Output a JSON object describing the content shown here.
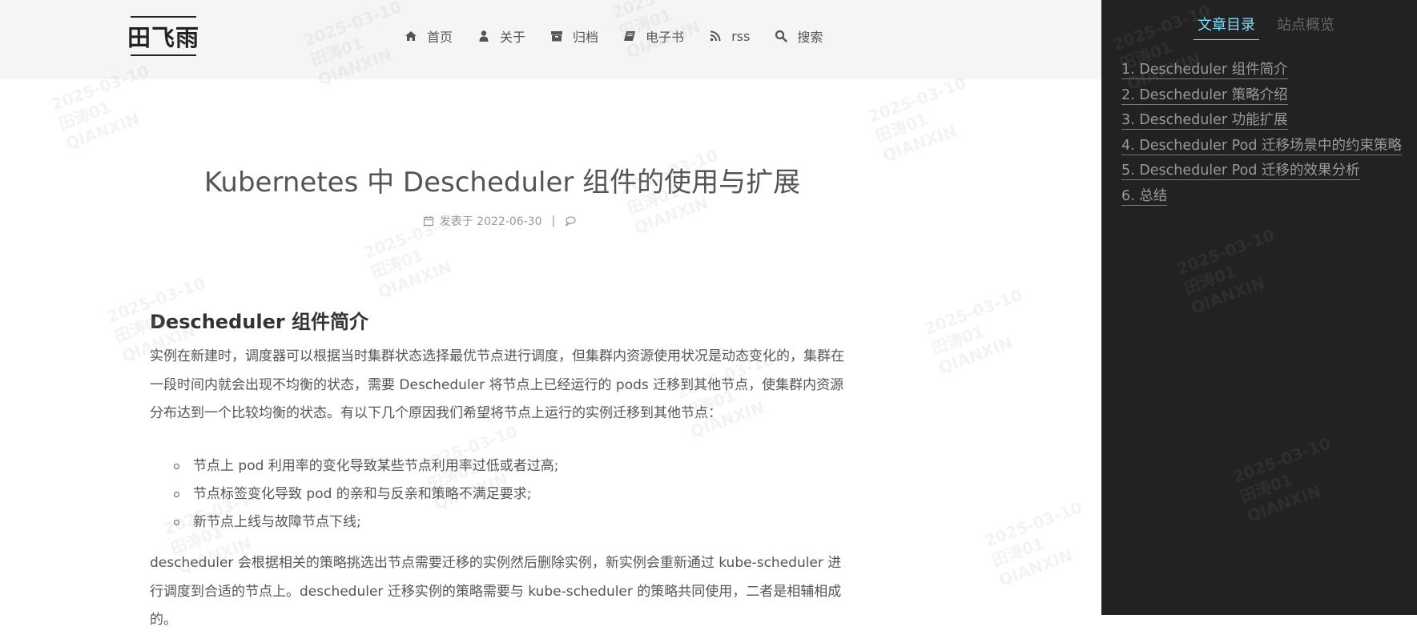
{
  "site": {
    "logo_text": "田飞雨"
  },
  "nav": {
    "items": [
      {
        "label": "首页",
        "icon": "home-icon"
      },
      {
        "label": "关于",
        "icon": "user-icon"
      },
      {
        "label": "归档",
        "icon": "archive-icon"
      },
      {
        "label": "电子书",
        "icon": "book-icon"
      },
      {
        "label": "rss",
        "icon": "rss-icon"
      },
      {
        "label": "搜索",
        "icon": "search-icon"
      }
    ]
  },
  "post": {
    "title": "Kubernetes 中 Descheduler 组件的使用与扩展",
    "meta": {
      "published": "发表于 2022-06-30",
      "divider": "|"
    },
    "section_title": "Descheduler 组件简介",
    "paragraph1": "实例在新建时，调度器可以根据当时集群状态选择最优节点进行调度，但集群内资源使用状况是动态变化的，集群在一段时间内就会出现不均衡的状态，需要 Descheduler 将节点上已经运行的 pods 迁移到其他节点，使集群内资源分布达到一个比较均衡的状态。有以下几个原因我们希望将节点上运行的实例迁移到其他节点：",
    "bullets": [
      "节点上 pod 利用率的变化导致某些节点利用率过低或者过高;",
      "节点标签变化导致 pod 的亲和与反亲和策略不满足要求;",
      "新节点上线与故障节点下线;"
    ],
    "paragraph2": "descheduler 会根据相关的策略挑选出节点需要迁移的实例然后删除实例，新实例会重新通过 kube-scheduler 进行调度到合适的节点上。descheduler 迁移实例的策略需要与 kube-scheduler 的策略共同使用，二者是相辅相成的。"
  },
  "sidebar": {
    "tabs": [
      {
        "label": "文章目录",
        "active": true
      },
      {
        "label": "站点概览",
        "active": false
      }
    ],
    "toc": [
      "1. Descheduler 组件简介",
      "2. Descheduler 策略介绍",
      "3. Descheduler 功能扩展",
      "4. Descheduler Pod 迁移场景中的约束策略",
      "5. Descheduler Pod 迁移的效果分析",
      "6. 总结"
    ]
  },
  "watermark": {
    "text": "2025-03-10\n田涛01\nQIANXIN"
  },
  "colors": {
    "sidebar_bg": "#222222",
    "accent": "#87daff",
    "header_bg": "#f5f5f5"
  }
}
